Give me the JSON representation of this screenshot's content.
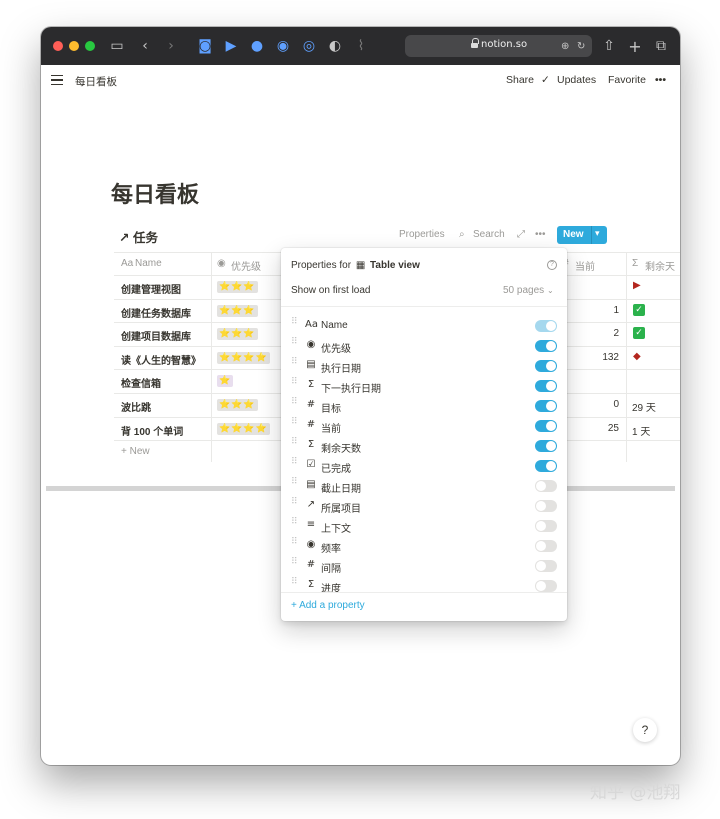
{
  "browser": {
    "url": "notion.so",
    "colors": {
      "close": "#ff5f57",
      "minimize": "#febc2e",
      "zoom": "#28c840"
    },
    "icons": [
      "sidebar-icon",
      "back-icon",
      "forward-icon",
      "pocket-icon",
      "extension-icon",
      "extension-icon",
      "extension-icon",
      "extension-icon",
      "shield-icon",
      "rss-icon",
      "translate-icon",
      "reload-icon",
      "share-icon",
      "new-tab-icon",
      "tabs-icon"
    ]
  },
  "topbar": {
    "breadcrumb": "每日看板",
    "share": "Share",
    "updates": "Updates",
    "favorite": "Favorite",
    "more": "•••"
  },
  "page": {
    "title": "每日看板"
  },
  "database": {
    "title": "↗ 任务",
    "properties": "Properties",
    "search": "Search",
    "new": "New",
    "headers": {
      "name": "Name",
      "priority": "优先级",
      "current": "当前",
      "remaining": "剩余天"
    },
    "rows": [
      {
        "name": "创建管理视图",
        "stars": "⭐⭐⭐",
        "current": "",
        "remaining_type": "flag",
        "remaining": "▶"
      },
      {
        "name": "创建任务数据库",
        "stars": "⭐⭐⭐",
        "current": "1",
        "remaining_type": "check",
        "remaining": "✓"
      },
      {
        "name": "创建项目数据库",
        "stars": "⭐⭐⭐",
        "current": "2",
        "remaining_type": "check",
        "remaining": "✓"
      },
      {
        "name": "读《人生的智慧》",
        "stars": "⭐⭐⭐⭐",
        "current": "132",
        "remaining_type": "flag",
        "remaining": "◆"
      },
      {
        "name": "检查信箱",
        "stars": "⭐",
        "current": "",
        "remaining_type": "text",
        "remaining": ""
      },
      {
        "name": "波比跳",
        "stars": "⭐⭐⭐",
        "current": "0",
        "remaining_type": "text",
        "remaining": "29 天"
      },
      {
        "name": "背 100 个单词",
        "stars": "⭐⭐⭐⭐",
        "current": "25",
        "remaining_type": "text",
        "remaining": "1 天"
      }
    ],
    "new_row": "+ New"
  },
  "popup": {
    "title_prefix": "Properties for",
    "view_name": "Table view",
    "show_first_load": "Show on first load",
    "pages": "50 pages",
    "add_property": "+ Add a property",
    "props": [
      {
        "icon": "Aa",
        "label": "Name",
        "state": "dim"
      },
      {
        "icon": "◉",
        "label": "优先级",
        "state": "on"
      },
      {
        "icon": "▤",
        "label": "执行日期",
        "state": "on"
      },
      {
        "icon": "Σ",
        "label": "下一执行日期",
        "state": "on"
      },
      {
        "icon": "#",
        "label": "目标",
        "state": "on"
      },
      {
        "icon": "#",
        "label": "当前",
        "state": "on"
      },
      {
        "icon": "Σ",
        "label": "剩余天数",
        "state": "on"
      },
      {
        "icon": "☑",
        "label": "已完成",
        "state": "on"
      },
      {
        "icon": "▤",
        "label": "截止日期",
        "state": "off"
      },
      {
        "icon": "↗",
        "label": "所属项目",
        "state": "off"
      },
      {
        "icon": "≡",
        "label": "上下文",
        "state": "off"
      },
      {
        "icon": "◉",
        "label": "频率",
        "state": "off"
      },
      {
        "icon": "#",
        "label": "间隔",
        "state": "off"
      },
      {
        "icon": "Σ",
        "label": "进度",
        "state": "off"
      }
    ]
  },
  "help": "?",
  "watermark": "知乎 @池翔"
}
